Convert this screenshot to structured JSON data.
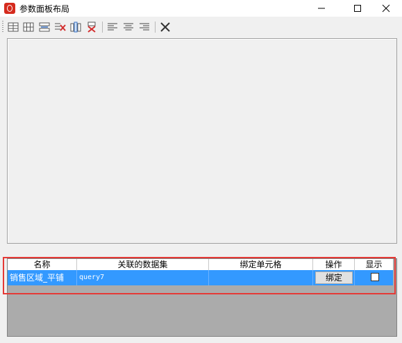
{
  "window": {
    "title": "参数面板布局",
    "controls": [
      "minimize-icon",
      "maximize-icon",
      "close-icon"
    ]
  },
  "toolbar": {
    "buttons": [
      "insert-row-icon",
      "insert-column-icon",
      "merge-rows-icon",
      "delete-rows-icon",
      "insert-columns-icon",
      "delete-columns-icon",
      "align-left-icon",
      "align-center-icon",
      "align-right-icon",
      "clear-icon"
    ]
  },
  "table": {
    "headers": [
      "名称",
      "关联的数据集",
      "绑定单元格",
      "操作",
      "显示"
    ],
    "rows": [
      {
        "name": "销售区域_平铺",
        "dataset": "query7",
        "cell": "",
        "action_label": "绑定",
        "show": false
      }
    ]
  },
  "colors": {
    "selected_row": "#3399ff",
    "highlight_outline": "#e53935",
    "app_icon": "#d52b1e"
  }
}
